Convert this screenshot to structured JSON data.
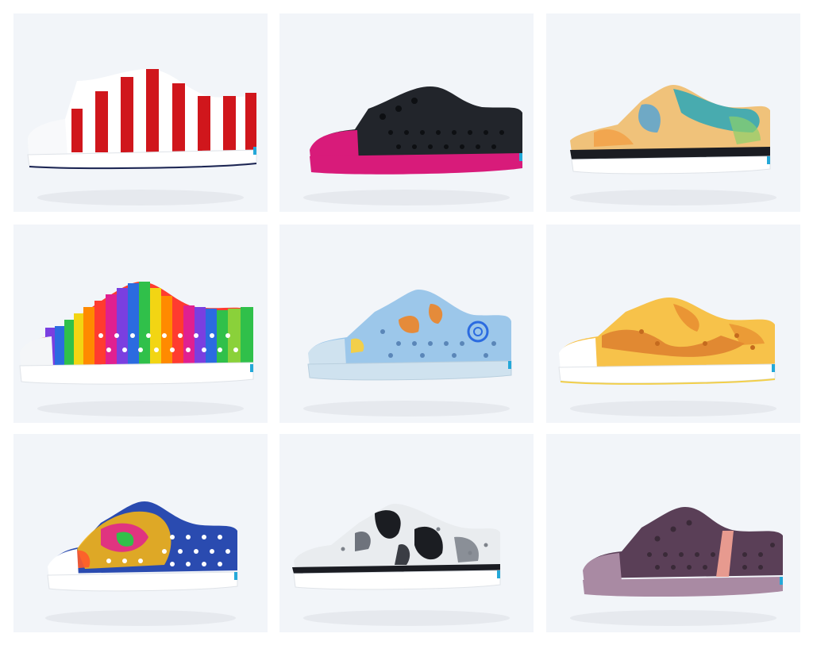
{
  "background": "#ffffff",
  "tile_background": "#f2f5f9",
  "tiles": [
    {
      "name": "shoe-flag-stripes",
      "upper": "#ffffff",
      "accent": "#d0161c",
      "toe": "#ffffff",
      "sole": "#ffffff",
      "pattern": "stripes"
    },
    {
      "name": "shoe-black-pink",
      "upper": "#22252b",
      "accent": "#22252b",
      "toe": "#d81b7a",
      "sole": "#d81b7a",
      "pattern": "solid"
    },
    {
      "name": "shoe-watercolor-teal-orange",
      "upper": "#f0c27a",
      "accent": "#2aa7b8",
      "toe": "#ffffff",
      "sole": "#ffffff",
      "pattern": "tie-dye"
    },
    {
      "name": "shoe-rainbow-stripes",
      "upper": "#ff3b30",
      "accent": "#2b6be0",
      "toe": "#ffffff",
      "sole": "#ffffff",
      "pattern": "rainbow"
    },
    {
      "name": "shoe-light-blue-print",
      "upper": "#9cc7ea",
      "accent": "#e58b3a",
      "toe": "#cfe2ef",
      "sole": "#cfe2ef",
      "pattern": "print"
    },
    {
      "name": "shoe-yellow-marble",
      "upper": "#f7c24a",
      "accent": "#d9762b",
      "toe": "#ffffff",
      "sole": "#ffffff",
      "pattern": "marble"
    },
    {
      "name": "shoe-tie-dye-blue",
      "upper": "#2a4bb0",
      "accent": "#f2b317",
      "toe": "#ffffff",
      "sole": "#ffffff",
      "pattern": "tie-dye-blue"
    },
    {
      "name": "shoe-black-white-marble",
      "upper": "#e9ecef",
      "accent": "#1b1d22",
      "toe": "#ffffff",
      "sole": "#ffffff",
      "pattern": "bw-marble"
    },
    {
      "name": "shoe-plum-stripe",
      "upper": "#5a3f57",
      "accent": "#e79a8f",
      "toe": "#a98aa3",
      "sole": "#a98aa3",
      "pattern": "plum"
    }
  ]
}
